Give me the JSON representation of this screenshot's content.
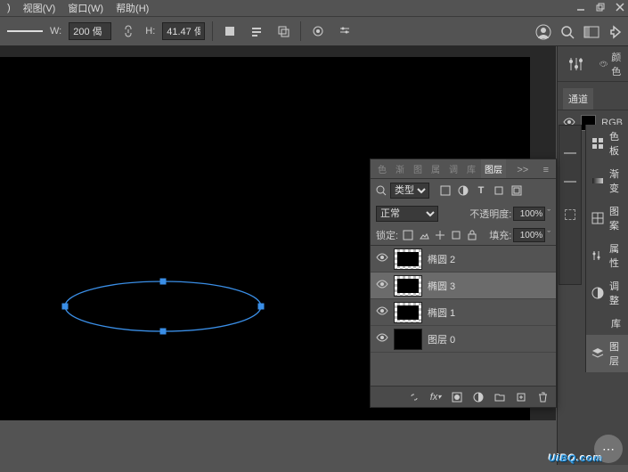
{
  "menu": {
    "item1": ")",
    "view": "视图(V)",
    "window": "窗口(W)",
    "help": "帮助(H)"
  },
  "optbar": {
    "w_label": "W:",
    "w_value": "200 偈",
    "h_label": "H:",
    "h_value": "41.47 偈",
    "link_icon": "link"
  },
  "right_top": {
    "color_tab": "颜色",
    "channels_tab": "通道",
    "rgb_label": "RGB"
  },
  "icon_dock": {
    "items": [
      {
        "label": "色板"
      },
      {
        "label": "渐变"
      },
      {
        "label": "图案"
      },
      {
        "label": "属性"
      },
      {
        "label": "调整"
      },
      {
        "label": "库"
      },
      {
        "label": "图层"
      }
    ]
  },
  "layers_panel": {
    "tabs": [
      "色",
      "渐",
      "图",
      "属",
      "调",
      "库"
    ],
    "active_tab": "图层",
    "more": ">>",
    "menu_icon": "≡",
    "filter_label": "类型",
    "blend_mode": "正常",
    "opacity_label": "不透明度:",
    "opacity_value": "100%",
    "lock_label": "锁定:",
    "fill_label": "填充:",
    "fill_value": "100%",
    "layers": [
      {
        "name": "椭圆 2",
        "selected": false,
        "thumb": "checker"
      },
      {
        "name": "椭圆 3",
        "selected": true,
        "thumb": "checker"
      },
      {
        "name": "椭圆 1",
        "selected": false,
        "thumb": "checker"
      },
      {
        "name": "图层 0",
        "selected": false,
        "thumb": "solid"
      }
    ]
  },
  "watermark": {
    "text": "UiBQ.com"
  }
}
